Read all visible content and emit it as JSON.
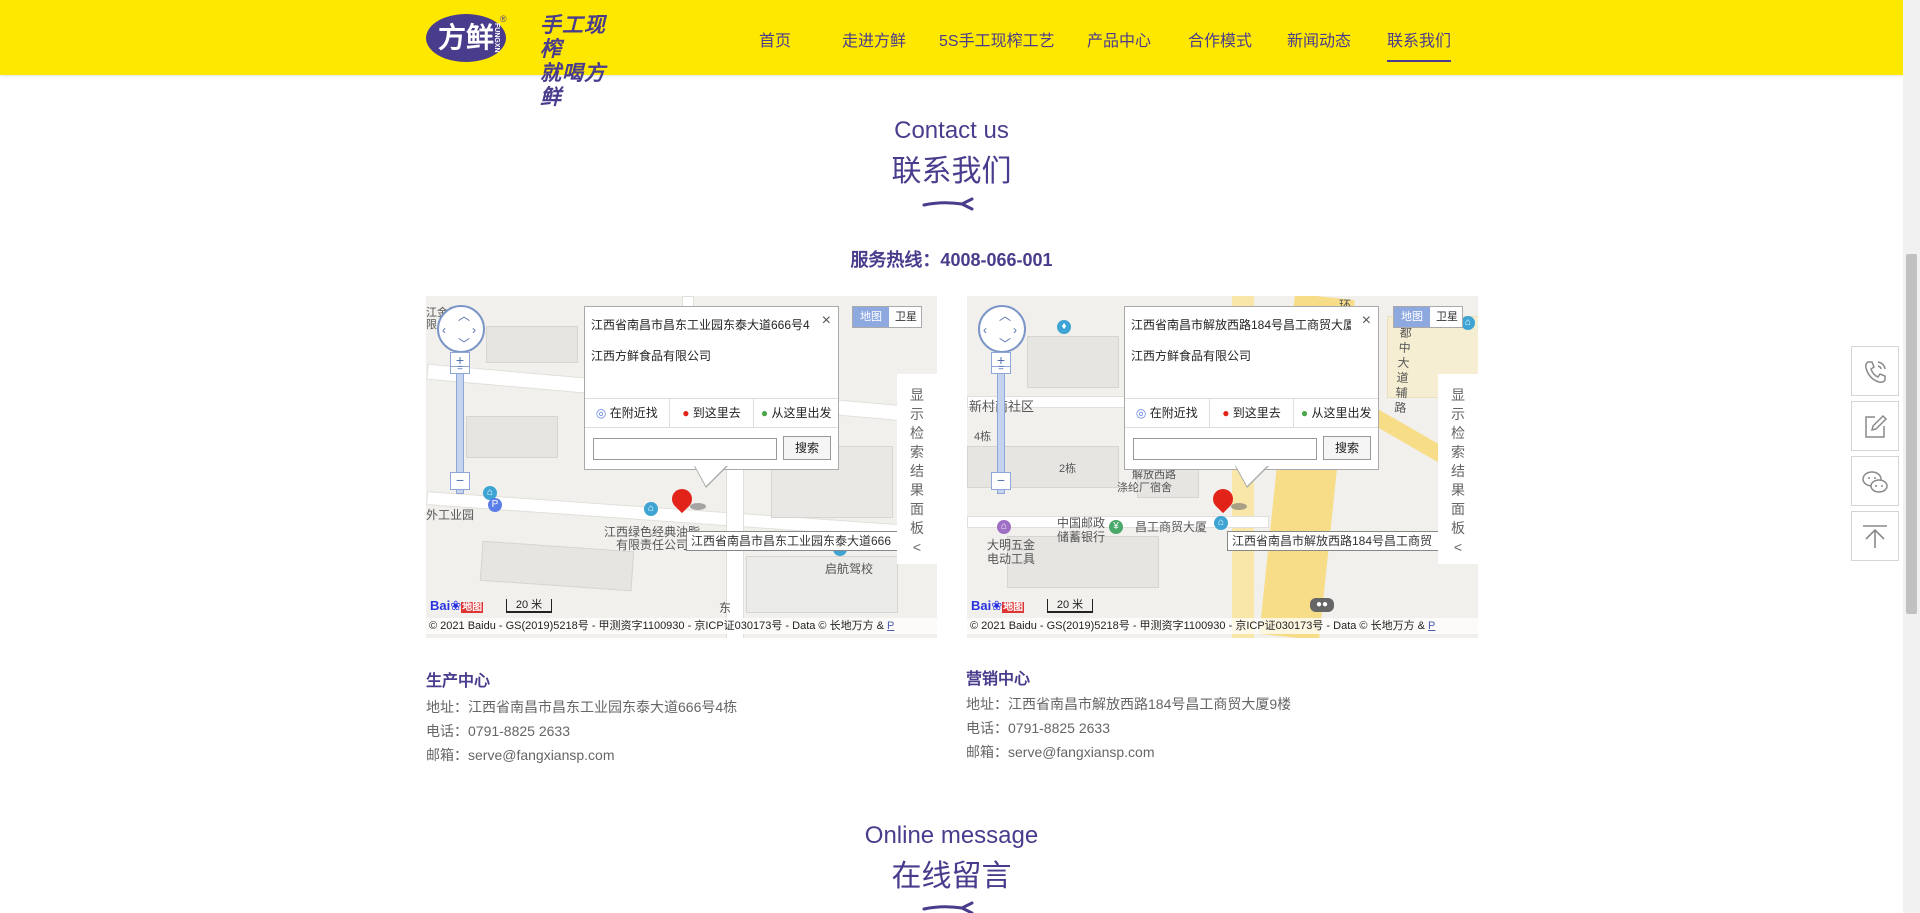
{
  "header": {
    "logo_text": "方鲜",
    "logo_small": "FUNGXN",
    "logo_reg": "®",
    "slogan_line1": "手工现榨",
    "slogan_line2": "就喝方鲜",
    "bg_color": "#ffe800",
    "nav": [
      {
        "label": "首页",
        "active": false
      },
      {
        "label": "走进方鲜",
        "active": false
      },
      {
        "label": "5S手工现榨工艺",
        "active": false
      },
      {
        "label": "产品中心",
        "active": false
      },
      {
        "label": "合作模式",
        "active": false
      },
      {
        "label": "新闻动态",
        "active": false
      },
      {
        "label": "联系我们",
        "active": true
      }
    ]
  },
  "contact": {
    "title_en": "Contact us",
    "title_cn": "联系我们",
    "hotline": "服务热线：4008-066-001"
  },
  "maps": [
    {
      "popup_title": "江西省南昌市昌东工业园东泰大道666号4",
      "popup_company": "江西方鲜食品有限公司",
      "actions": [
        "在附近找",
        "到这里去",
        "从这里出发"
      ],
      "search_button": "搜索",
      "map_type_on": "地图",
      "map_type_off": "卫星",
      "side_panel": "显示检索结果面板",
      "side_arrow": "<",
      "marker_label": "江西省南昌市昌东工业园东泰大道666",
      "labels": [
        "江金维",
        "限公",
        "外工业园",
        "江西绿色经典油脂",
        "有限责任公司",
        "启航驾校",
        "东"
      ],
      "scale": "20 米",
      "copyright": "© 2021 Baidu - GS(2019)5218号 - 甲测资字1100930 - 京ICP证030173号 - Data © 长地万方 & ",
      "copyright_link": "P"
    },
    {
      "popup_title": "江西省南昌市解放西路184号昌工商贸大厦",
      "popup_company": "江西方鲜食品有限公司",
      "actions": [
        "在附近找",
        "到这里去",
        "从这里出发"
      ],
      "search_button": "搜索",
      "map_type_on": "地图",
      "map_type_off": "卫星",
      "side_panel": "显示检索结果面板",
      "side_arrow": "<",
      "marker_label": "江西省南昌市解放西路184号昌工商贸",
      "labels": [
        "新村南社区",
        "4栋",
        "2栋",
        "解放西路",
        "涤纶厂宿舍",
        "中国邮政",
        "储蓄银行",
        "昌工商贸大厦",
        "大明五金",
        "电动工具",
        "都中大道辅路",
        "环"
      ],
      "scale": "20 米",
      "copyright": "© 2021 Baidu - GS(2019)5218号 - 甲测资字1100930 - 京ICP证030173号 - Data © 长地万方 & ",
      "copyright_link": "P"
    }
  ],
  "map_logo": {
    "bai": "Bai",
    "du": "地图"
  },
  "addresses": [
    {
      "title": "生产中心",
      "address": "地址：江西省南昌市昌东工业园东泰大道666号4栋",
      "phone": "电话：0791-8825 2633",
      "email": "邮箱：serve@fangxiansp.com"
    },
    {
      "title": "营销中心",
      "address": "地址：江西省南昌市解放西路184号昌工商贸大厦9楼",
      "phone": "电话：0791-8825 2633",
      "email": "邮箱：serve@fangxiansp.com"
    }
  ],
  "message": {
    "title_en": "Online message",
    "title_cn": "在线留言"
  },
  "floating": [
    {
      "icon": "phone-icon"
    },
    {
      "icon": "edit-icon"
    },
    {
      "icon": "wechat-icon"
    },
    {
      "icon": "back-to-top-icon"
    }
  ],
  "colors": {
    "brand_purple": "#4a3c8c",
    "brand_yellow": "#ffe800"
  }
}
